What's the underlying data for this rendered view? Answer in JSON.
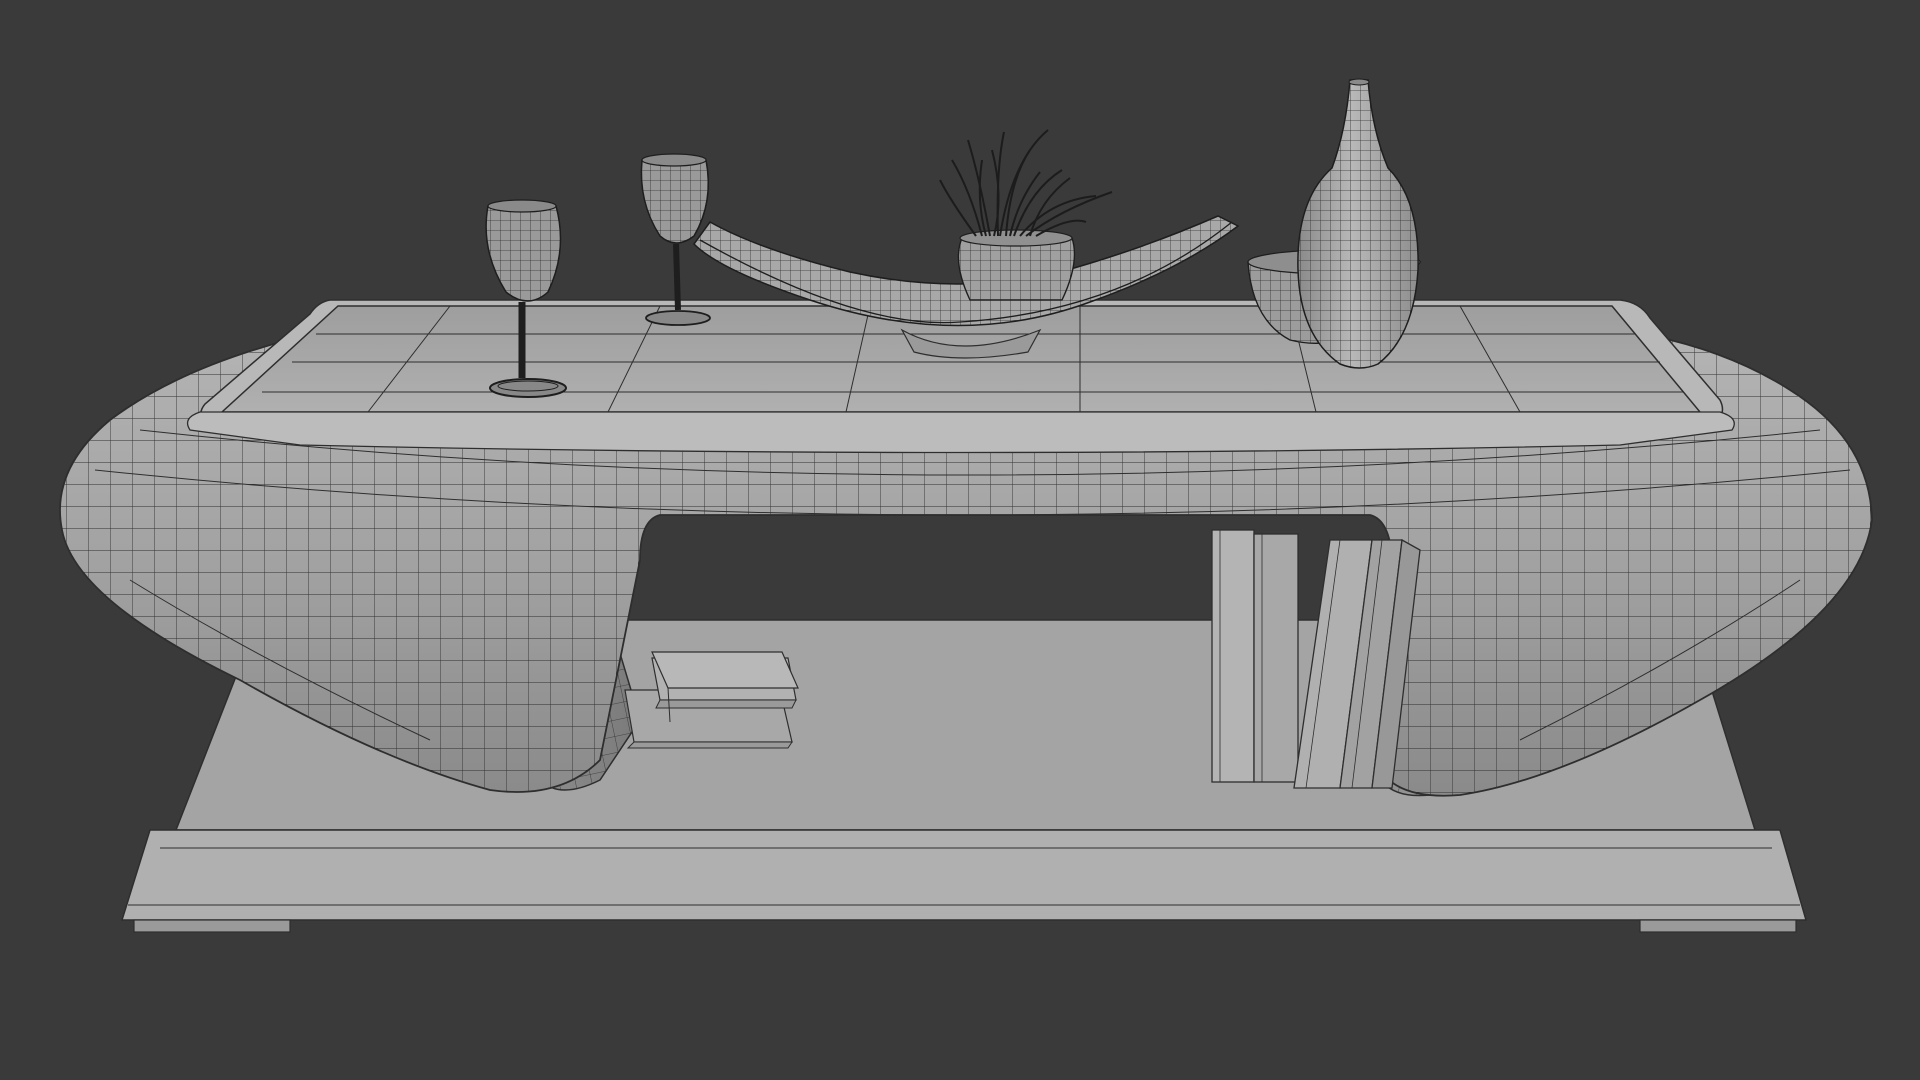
{
  "scene": {
    "background_color": "#3a3a3a",
    "clay_color": "#a6a6a6",
    "wire_color": "#2a2a2a",
    "objects": [
      "coffee-table",
      "table-base-plinth",
      "left-leg",
      "right-leg",
      "wine-glass",
      "wine-glass",
      "curved-tray",
      "plant-pot",
      "grass-plant",
      "bowl",
      "vase",
      "stacked-books",
      "standing-books"
    ]
  }
}
